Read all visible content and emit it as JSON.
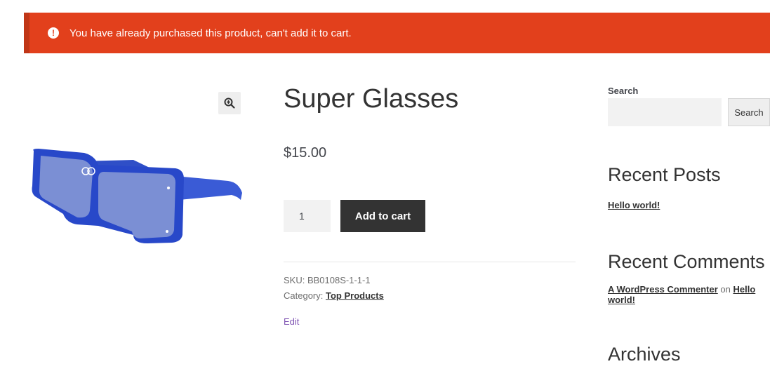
{
  "notice": {
    "icon": "alert-circle-icon",
    "text": "You have already purchased this product, can't add it to cart.",
    "color": "#e2401c"
  },
  "product": {
    "title": "Super Glasses",
    "price": "$15.00",
    "quantity": "1",
    "add_to_cart_label": "Add to cart",
    "sku_label": "SKU:",
    "sku_value": "BB0108S-1-1-1",
    "category_label": "Category:",
    "category_value": "Top Products",
    "edit_label": "Edit",
    "image_alt_icon": "sunglasses-image",
    "zoom_icon": "zoom-in-icon"
  },
  "sidebar": {
    "search_label": "Search",
    "search_button": "Search",
    "recent_posts_title": "Recent Posts",
    "recent_posts": [
      "Hello world!"
    ],
    "recent_comments_title": "Recent Comments",
    "recent_comment_author": "A WordPress Commenter",
    "recent_comment_on": "on",
    "recent_comment_post": "Hello world!",
    "archives_title": "Archives"
  },
  "colors": {
    "accent": "#e2401c",
    "button_dark": "#333333",
    "edit_link": "#7f54b3"
  }
}
